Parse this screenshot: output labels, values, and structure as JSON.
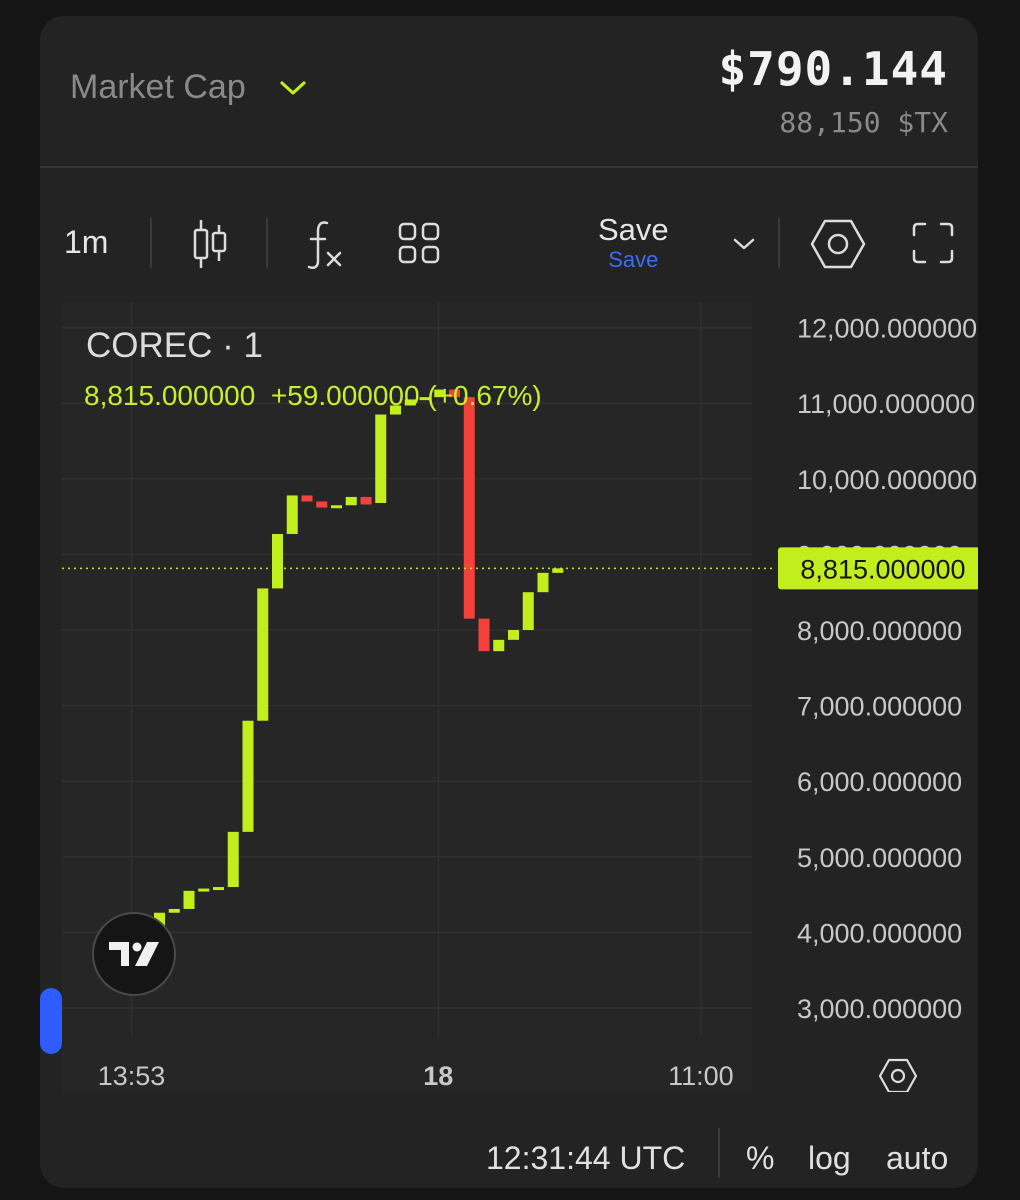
{
  "header": {
    "metric_label": "Market Cap",
    "price": "$790.144",
    "sub_amount": "88,150 $TX"
  },
  "toolbar": {
    "interval": "1m",
    "save_label": "Save",
    "save_status": "Save"
  },
  "chart": {
    "symbol_title": "COREC · 1",
    "ohlc_last": "8,815.000000",
    "ohlc_change": "+59.000000 (+0.67%)",
    "last_price_label": "8,815.000000",
    "colors": {
      "up": "#c3ee1d",
      "down": "#f5413b",
      "grid": "#303030",
      "axis_text": "#c8c8c8"
    }
  },
  "chart_data": {
    "type": "candlestick",
    "y_ticks": [
      "3,000.000000",
      "4,000.000000",
      "5,000.000000",
      "6,000.000000",
      "7,000.000000",
      "8,000.000000",
      "9,000.000000",
      "10,000.000000",
      "11,000.000000",
      "12,000.000000"
    ],
    "y_tick_values": [
      3000,
      4000,
      5000,
      6000,
      7000,
      8000,
      9000,
      10000,
      11000,
      12000
    ],
    "ylim": [
      2900,
      12100
    ],
    "x_ticks": [
      {
        "label": "13:53",
        "bold": false,
        "index": 0
      },
      {
        "label": "18",
        "bold": true,
        "index": 20.8
      },
      {
        "label": "11:00",
        "bold": false,
        "index": 38.6
      }
    ],
    "last_price": 8815,
    "candles": [
      {
        "o": 4050,
        "c": 4260,
        "dir": "up"
      },
      {
        "o": 4260,
        "c": 4310,
        "dir": "up"
      },
      {
        "o": 4310,
        "c": 4550,
        "dir": "up"
      },
      {
        "o": 4550,
        "c": 4580,
        "dir": "up"
      },
      {
        "o": 4580,
        "c": 4600,
        "dir": "up"
      },
      {
        "o": 4600,
        "c": 5330,
        "dir": "up"
      },
      {
        "o": 5330,
        "c": 6800,
        "dir": "up"
      },
      {
        "o": 6800,
        "c": 8550,
        "dir": "up"
      },
      {
        "o": 8550,
        "c": 9270,
        "dir": "up"
      },
      {
        "o": 9270,
        "c": 9780,
        "dir": "up"
      },
      {
        "o": 9780,
        "c": 9700,
        "dir": "down"
      },
      {
        "o": 9700,
        "c": 9620,
        "dir": "down"
      },
      {
        "o": 9620,
        "c": 9650,
        "dir": "up"
      },
      {
        "o": 9650,
        "c": 9760,
        "dir": "up"
      },
      {
        "o": 9760,
        "c": 9660,
        "dir": "down"
      },
      {
        "o": 9680,
        "c": 10850,
        "dir": "up"
      },
      {
        "o": 10850,
        "c": 10970,
        "dir": "up"
      },
      {
        "o": 10970,
        "c": 11050,
        "dir": "up"
      },
      {
        "o": 11050,
        "c": 11080,
        "dir": "up"
      },
      {
        "o": 11080,
        "c": 11180,
        "dir": "up"
      },
      {
        "o": 11180,
        "c": 11080,
        "dir": "down"
      },
      {
        "o": 11080,
        "c": 8150,
        "dir": "down"
      },
      {
        "o": 8150,
        "c": 7720,
        "dir": "down"
      },
      {
        "o": 7720,
        "c": 7870,
        "dir": "up"
      },
      {
        "o": 7870,
        "c": 8000,
        "dir": "up"
      },
      {
        "o": 8000,
        "c": 8500,
        "dir": "up"
      },
      {
        "o": 8500,
        "c": 8756,
        "dir": "up"
      },
      {
        "o": 8756,
        "c": 8815,
        "dir": "up"
      }
    ]
  },
  "footer": {
    "time": "12:31:44 UTC",
    "percent": "%",
    "log": "log",
    "auto": "auto"
  }
}
